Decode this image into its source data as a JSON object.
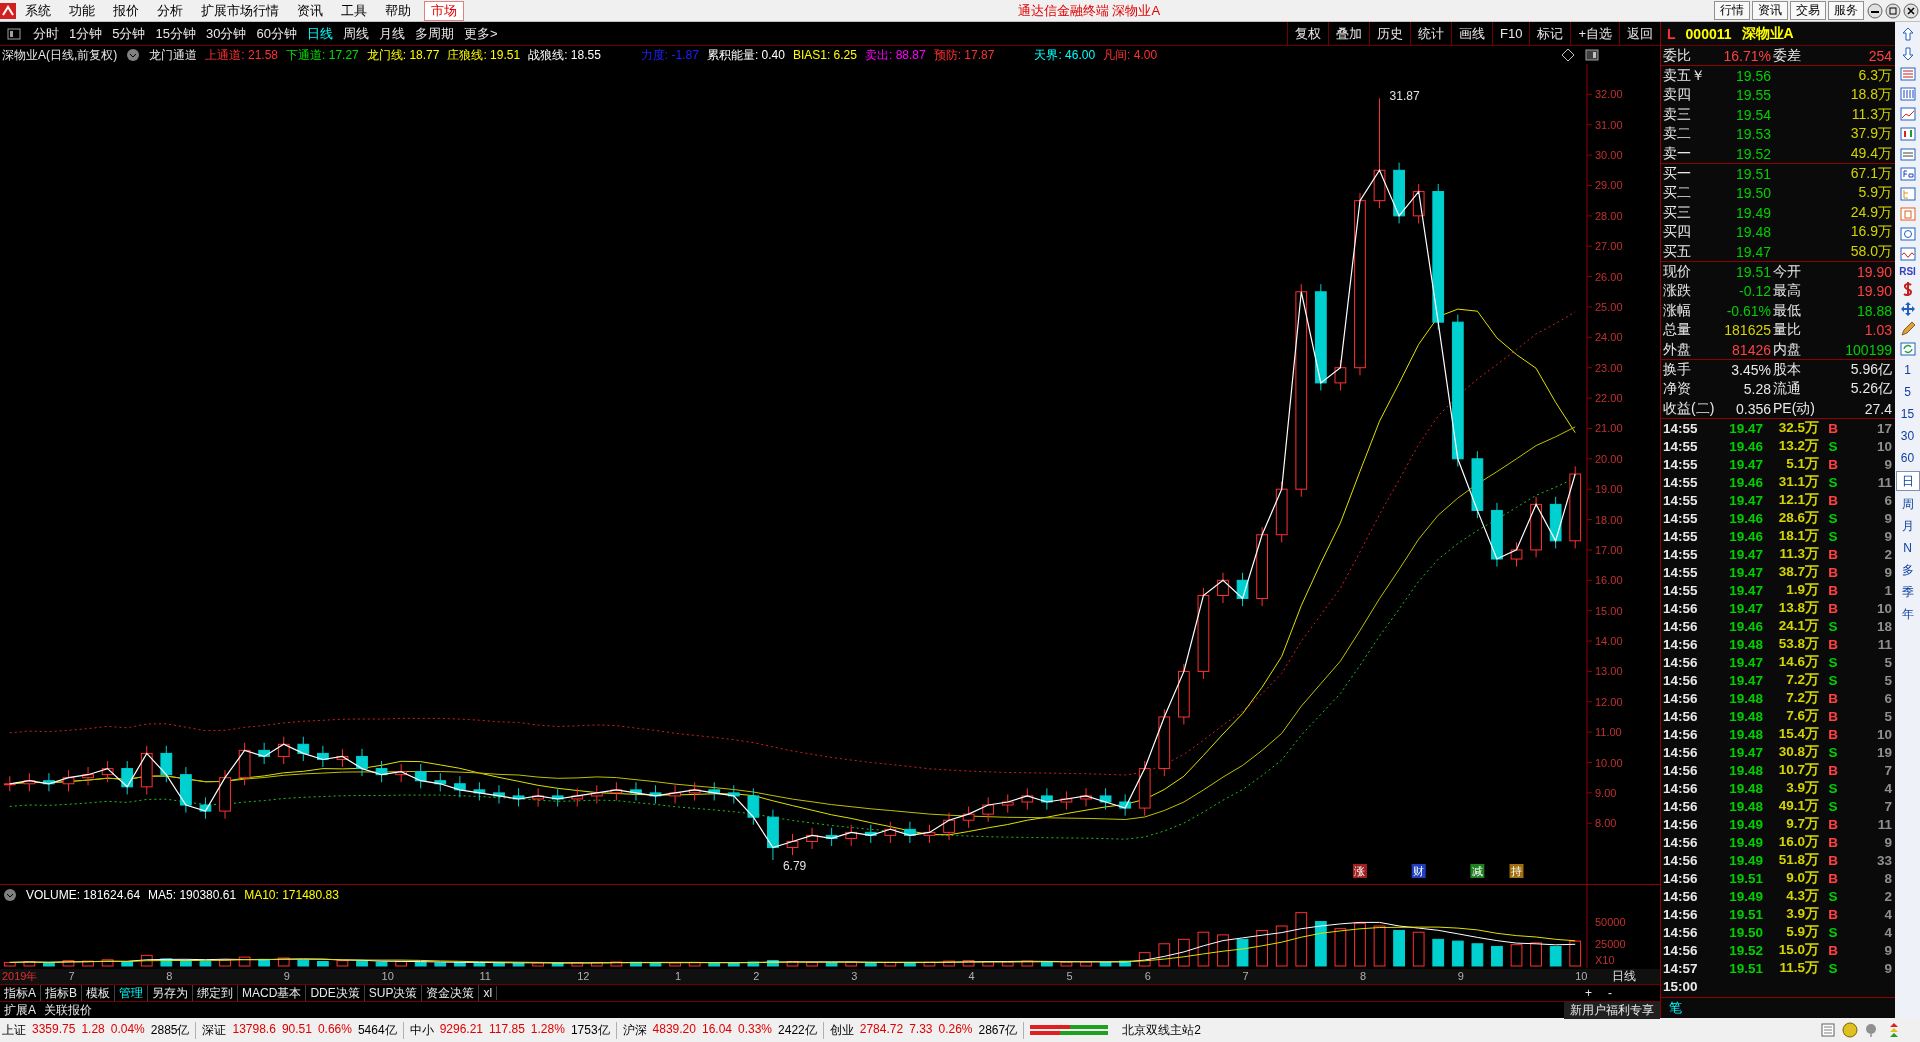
{
  "menu_bar": {
    "items": [
      "系统",
      "功能",
      "报价",
      "分析",
      "扩展市场行情",
      "资讯",
      "工具",
      "帮助"
    ],
    "market": "市场",
    "title": "通达信金融终端 深物业A",
    "buttons": [
      "行情",
      "资讯",
      "交易",
      "服务"
    ]
  },
  "periods": {
    "items": [
      {
        "label": "分时",
        "selected": false
      },
      {
        "label": "1分钟",
        "selected": false
      },
      {
        "label": "5分钟",
        "selected": false
      },
      {
        "label": "15分钟",
        "selected": false
      },
      {
        "label": "30分钟",
        "selected": false
      },
      {
        "label": "60分钟",
        "selected": false
      },
      {
        "label": "日线",
        "selected": true
      },
      {
        "label": "周线",
        "selected": false
      },
      {
        "label": "月线",
        "selected": false
      },
      {
        "label": "多周期",
        "selected": false
      },
      {
        "label": "更多>",
        "selected": false
      }
    ],
    "tools": [
      "复权",
      "叠加",
      "历史",
      "统计",
      "画线",
      "F10",
      "标记",
      "+自选",
      "返回"
    ]
  },
  "indicator": {
    "title": "深物业A(日线,前复权)",
    "name": "龙门通道",
    "values": [
      {
        "text": "上通道: 21.58",
        "color": "#ff3030"
      },
      {
        "text": "下通道: 17.27",
        "color": "#00e000"
      },
      {
        "text": "龙门线: 18.77",
        "color": "#ffff00"
      },
      {
        "text": "庄狼线: 19.51",
        "color": "#ffff00"
      },
      {
        "text": "战狼线: 18.55",
        "color": "#ffffff"
      },
      {
        "text": "力度: -1.87",
        "color": "#2020ff"
      },
      {
        "text": "累积能量: 0.40",
        "color": "#ffffff"
      },
      {
        "text": "BIAS1: 6.25",
        "color": "#ffff00"
      },
      {
        "text": "卖出: 88.87",
        "color": "#ff00ff"
      },
      {
        "text": "预防: 17.87",
        "color": "#ff3030"
      },
      {
        "text": "天界: 46.00",
        "color": "#00ffff"
      },
      {
        "text": "凡间: 4.00",
        "color": "#ff3030"
      }
    ]
  },
  "price_chart": {
    "axis_labels": [
      "32.00",
      "31.00",
      "30.00",
      "29.00",
      "28.00",
      "27.00",
      "26.00",
      "25.00",
      "24.00",
      "23.00",
      "22.00",
      "21.00",
      "20.00",
      "19.00",
      "18.00",
      "17.00",
      "16.00",
      "15.00",
      "14.00",
      "13.00",
      "12.00",
      "11.00",
      "10.00",
      "9.00",
      "8.00"
    ],
    "annotations": [
      "31.87",
      "6.79"
    ],
    "event_marks": [
      {
        "text": "涨",
        "color": "#a02020"
      },
      {
        "text": "财",
        "color": "#2040c0"
      },
      {
        "text": "减",
        "color": "#208020"
      },
      {
        "text": "持",
        "color": "#a07010"
      }
    ]
  },
  "volume_chart": {
    "legend": [
      {
        "text": "VOLUME: 181624.64",
        "color": "#ffffff"
      },
      {
        "text": "MA5: 190380.61",
        "color": "#ffffff"
      },
      {
        "text": "MA10: 171480.83",
        "color": "#ffff00"
      }
    ],
    "axis_labels": [
      "50000",
      "25000"
    ],
    "scale_label": "X10",
    "period_label": "日线",
    "date_axis": [
      "2019年",
      "7",
      "8",
      "9",
      "10",
      "11",
      "12",
      "1",
      "2",
      "3",
      "4",
      "5",
      "6",
      "7",
      "8",
      "9",
      "10"
    ]
  },
  "indicator_tabs": {
    "items": [
      {
        "label": "指标A",
        "selected": false
      },
      {
        "label": "指标B",
        "selected": false
      },
      {
        "label": "模板",
        "selected": false
      },
      {
        "label": "管理",
        "selected": true
      },
      {
        "label": "另存为",
        "selected": false
      },
      {
        "label": "绑定到",
        "selected": false
      },
      {
        "label": "MACD基本",
        "selected": false
      },
      {
        "label": "DDE决策",
        "selected": false
      },
      {
        "label": "SUP决策",
        "selected": false
      },
      {
        "label": "资金决策",
        "selected": false
      },
      {
        "label": "xl",
        "selected": false
      }
    ],
    "zoom_buttons": [
      "+",
      "-"
    ]
  },
  "extension_row": {
    "items": [
      "扩展A",
      "关联报价"
    ],
    "promo": "新用户福利专享"
  },
  "quote": {
    "flag": "L",
    "code": "000011",
    "name": "深物业A",
    "ratio": {
      "label": "委比",
      "value": "16.71%",
      "label2": "委差",
      "value2": "254"
    },
    "asks": [
      {
        "label": "卖五￥",
        "price": "19.56",
        "volume": "6.3万"
      },
      {
        "label": "卖四",
        "price": "19.55",
        "volume": "18.8万"
      },
      {
        "label": "卖三",
        "price": "19.54",
        "volume": "11.3万"
      },
      {
        "label": "卖二",
        "price": "19.53",
        "volume": "37.9万"
      },
      {
        "label": "卖一",
        "price": "19.52",
        "volume": "49.4万"
      }
    ],
    "bids": [
      {
        "label": "买一",
        "price": "19.51",
        "volume": "67.1万"
      },
      {
        "label": "买二",
        "price": "19.50",
        "volume": "5.9万"
      },
      {
        "label": "买三",
        "price": "19.49",
        "volume": "24.9万"
      },
      {
        "label": "买四",
        "price": "19.48",
        "volume": "16.9万"
      },
      {
        "label": "买五",
        "price": "19.47",
        "volume": "58.0万"
      }
    ],
    "stats": [
      {
        "cells": [
          {
            "label": "现价",
            "value": "19.51",
            "color": "#00d000"
          },
          {
            "label": "今开",
            "value": "19.90",
            "color": "#ff4040"
          }
        ]
      },
      {
        "cells": [
          {
            "label": "涨跌",
            "value": "-0.12",
            "color": "#00d000"
          },
          {
            "label": "最高",
            "value": "19.90",
            "color": "#ff4040"
          }
        ]
      },
      {
        "cells": [
          {
            "label": "涨幅",
            "value": "-0.61%",
            "color": "#00d000"
          },
          {
            "label": "最低",
            "value": "18.88",
            "color": "#00d000"
          }
        ]
      },
      {
        "cells": [
          {
            "label": "总量",
            "value": "181625",
            "color": "#d4d400"
          },
          {
            "label": "量比",
            "value": "1.03",
            "color": "#ff4040"
          }
        ]
      },
      {
        "cells": [
          {
            "label": "外盘",
            "value": "81426",
            "color": "#ff4040"
          },
          {
            "label": "内盘",
            "value": "100199",
            "color": "#00d000"
          }
        ]
      }
    ],
    "fundamentals": [
      {
        "label": "换手",
        "value": "3.45%",
        "label2": "股本",
        "value2": "5.96亿"
      },
      {
        "label": "净资",
        "value": "5.28",
        "label2": "流通",
        "value2": "5.26亿"
      },
      {
        "label": "收益(二)",
        "value": "0.356",
        "label2": "PE(动)",
        "value2": "27.4"
      }
    ]
  },
  "trades": [
    {
      "time": "14:55",
      "price": "19.47",
      "volume": "32.5万",
      "side": "B",
      "kind": "buy",
      "count": "17"
    },
    {
      "time": "14:55",
      "price": "19.46",
      "volume": "13.2万",
      "side": "S",
      "kind": "sell",
      "count": "10"
    },
    {
      "time": "14:55",
      "price": "19.47",
      "volume": "5.1万",
      "side": "B",
      "kind": "buy",
      "count": "9"
    },
    {
      "time": "14:55",
      "price": "19.46",
      "volume": "31.1万",
      "side": "S",
      "kind": "sell",
      "count": "11"
    },
    {
      "time": "14:55",
      "price": "19.47",
      "volume": "12.1万",
      "side": "B",
      "kind": "buy",
      "count": "6"
    },
    {
      "time": "14:55",
      "price": "19.46",
      "volume": "28.6万",
      "side": "S",
      "kind": "sell",
      "count": "9"
    },
    {
      "time": "14:55",
      "price": "19.46",
      "volume": "18.1万",
      "side": "S",
      "kind": "sell",
      "count": "9"
    },
    {
      "time": "14:55",
      "price": "19.47",
      "volume": "11.3万",
      "side": "B",
      "kind": "buy",
      "count": "2"
    },
    {
      "time": "14:55",
      "price": "19.47",
      "volume": "38.7万",
      "side": "B",
      "kind": "buy",
      "count": "9"
    },
    {
      "time": "14:55",
      "price": "19.47",
      "volume": "1.9万",
      "side": "B",
      "kind": "buy",
      "count": "1"
    },
    {
      "time": "14:56",
      "price": "19.47",
      "volume": "13.8万",
      "side": "B",
      "kind": "buy",
      "count": "10"
    },
    {
      "time": "14:56",
      "price": "19.46",
      "volume": "24.1万",
      "side": "S",
      "kind": "sell",
      "count": "18"
    },
    {
      "time": "14:56",
      "price": "19.48",
      "volume": "53.8万",
      "side": "B",
      "kind": "buy",
      "count": "11"
    },
    {
      "time": "14:56",
      "price": "19.47",
      "volume": "14.6万",
      "side": "S",
      "kind": "sell",
      "count": "5"
    },
    {
      "time": "14:56",
      "price": "19.47",
      "volume": "7.2万",
      "side": "S",
      "kind": "sell",
      "count": "5"
    },
    {
      "time": "14:56",
      "price": "19.48",
      "volume": "7.2万",
      "side": "B",
      "kind": "buy",
      "count": "6"
    },
    {
      "time": "14:56",
      "price": "19.48",
      "volume": "7.6万",
      "side": "B",
      "kind": "buy",
      "count": "5"
    },
    {
      "time": "14:56",
      "price": "19.48",
      "volume": "15.4万",
      "side": "B",
      "kind": "buy",
      "count": "10"
    },
    {
      "time": "14:56",
      "price": "19.47",
      "volume": "30.8万",
      "side": "S",
      "kind": "sell",
      "count": "19"
    },
    {
      "time": "14:56",
      "price": "19.48",
      "volume": "10.7万",
      "side": "B",
      "kind": "buy",
      "count": "7"
    },
    {
      "time": "14:56",
      "price": "19.48",
      "volume": "3.9万",
      "side": "S",
      "kind": "sell",
      "count": "4"
    },
    {
      "time": "14:56",
      "price": "19.48",
      "volume": "49.1万",
      "side": "S",
      "kind": "sell",
      "count": "7"
    },
    {
      "time": "14:56",
      "price": "19.49",
      "volume": "9.7万",
      "side": "B",
      "kind": "buy",
      "count": "11"
    },
    {
      "time": "14:56",
      "price": "19.49",
      "volume": "16.0万",
      "side": "B",
      "kind": "buy",
      "count": "9"
    },
    {
      "time": "14:56",
      "price": "19.49",
      "volume": "51.8万",
      "side": "B",
      "kind": "buy",
      "count": "33"
    },
    {
      "time": "14:56",
      "price": "19.51",
      "volume": "9.0万",
      "side": "B",
      "kind": "buy",
      "count": "8"
    },
    {
      "time": "14:56",
      "price": "19.49",
      "volume": "4.3万",
      "side": "S",
      "kind": "sell",
      "count": "2"
    },
    {
      "time": "14:56",
      "price": "19.51",
      "volume": "3.9万",
      "side": "B",
      "kind": "buy",
      "count": "4"
    },
    {
      "time": "14:56",
      "price": "19.50",
      "volume": "5.9万",
      "side": "S",
      "kind": "sell",
      "count": "4"
    },
    {
      "time": "14:56",
      "price": "19.52",
      "volume": "15.0万",
      "side": "B",
      "kind": "buy",
      "count": "9"
    },
    {
      "time": "14:57",
      "price": "19.51",
      "volume": "11.5万",
      "side": "S",
      "kind": "sell",
      "count": "9"
    },
    {
      "time": "15:00"
    }
  ],
  "detail_tabs": [
    {
      "label": "笔",
      "selected": true
    }
  ],
  "right_toolbar": {
    "rsi": "RSI",
    "periods": [
      {
        "label": "1",
        "selected": false
      },
      {
        "label": "5",
        "selected": false
      },
      {
        "label": "15",
        "selected": false
      },
      {
        "label": "30",
        "selected": false
      },
      {
        "label": "60",
        "selected": false
      },
      {
        "label": "日",
        "selected": true
      },
      {
        "label": "周",
        "selected": false
      },
      {
        "label": "月",
        "selected": false
      },
      {
        "label": "N",
        "selected": false
      },
      {
        "label": "多",
        "selected": false
      },
      {
        "label": "季",
        "selected": false
      },
      {
        "label": "年",
        "selected": false
      }
    ]
  },
  "status_bar": {
    "indices": [
      {
        "name": "上证",
        "value": "3359.75",
        "change": "1.28",
        "percent": "0.04%",
        "amount": "2885亿"
      },
      {
        "name": "深证",
        "value": "13798.6",
        "change": "90.51",
        "percent": "0.66%",
        "amount": "5464亿"
      },
      {
        "name": "中小",
        "value": "9296.21",
        "change": "117.85",
        "percent": "1.28%",
        "amount": "1753亿"
      },
      {
        "name": "沪深",
        "value": "4839.20",
        "change": "16.04",
        "percent": "0.33%",
        "amount": "2422亿"
      },
      {
        "name": "创业",
        "value": "2784.72",
        "change": "7.33",
        "percent": "0.26%",
        "amount": "2867亿"
      }
    ],
    "server": "北京双线主站2"
  }
}
